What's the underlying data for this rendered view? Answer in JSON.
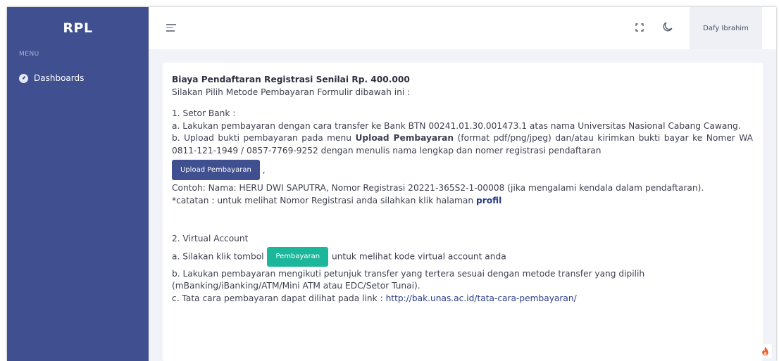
{
  "sidebar": {
    "brand": "RPL",
    "menu_label": "MENU",
    "items": [
      {
        "label": "Dashboards",
        "icon": "gauge-icon"
      }
    ]
  },
  "topbar": {
    "user_name": "Dafy Ibrahim",
    "icons": [
      "hamburger-menu-icon",
      "fullscreen-icon",
      "moon-icon"
    ]
  },
  "content": {
    "title": "Biaya Pendaftaran Registrasi Senilai Rp. 400.000",
    "intro": "Silakan Pilih Metode Pembayaran Formulir dibawah ini :",
    "bank": {
      "heading": "1. Setor Bank :",
      "step_a": "a. Lakukan pembayaran dengan cara transfer ke Bank BTN 00241.01.30.001473.1 atas nama Universitas Nasional Cabang Cawang.",
      "step_b_prefix": "b. Upload bukti pembayaran pada menu ",
      "step_b_bold": "Upload Pembayaran",
      "step_b_suffix": " (format pdf/png/jpeg) dan/atau kirimkan bukti bayar ke Nomer WA 0811-121-1949 / 0857-7769-9252 dengan menulis nama lengkap dan nomer registrasi pendaftaran",
      "upload_button": "Upload Pembayaran",
      "after_button": ",",
      "example": "Contoh: Nama: HERU DWI SAPUTRA, Nomor Registrasi 20221-365S2-1-00008 (jika mengalami kendala dalam pendaftaran).",
      "note_prefix": "*catatan : untuk melihat Nomor Registrasi anda silahkan klik halaman ",
      "note_link": "profil"
    },
    "va": {
      "heading": "2. Virtual Account",
      "step_a_prefix": "a. Silakan klik tombol ",
      "pay_button": "Pembayaran",
      "step_a_suffix": " untuk melihat kode virtual account anda",
      "step_b": "b. Lakukan pembayaran mengikuti petunjuk transfer yang tertera sesuai dengan metode transfer yang dipilih (mBanking/iBanking/ATM/Mini ATM atau EDC/Setor Tunai).",
      "step_c_prefix": "c. Tata cara pembayaran dapat dilihat pada link : ",
      "step_c_link": "http://bak.unas.ac.id/tata-cara-pembayaran/"
    }
  },
  "colors": {
    "sidebar": "#3f4f8f",
    "primary_button": "#3f4f8f",
    "success_button": "#1cb79a",
    "link": "#2b3c86",
    "fire": "#f0582a"
  }
}
